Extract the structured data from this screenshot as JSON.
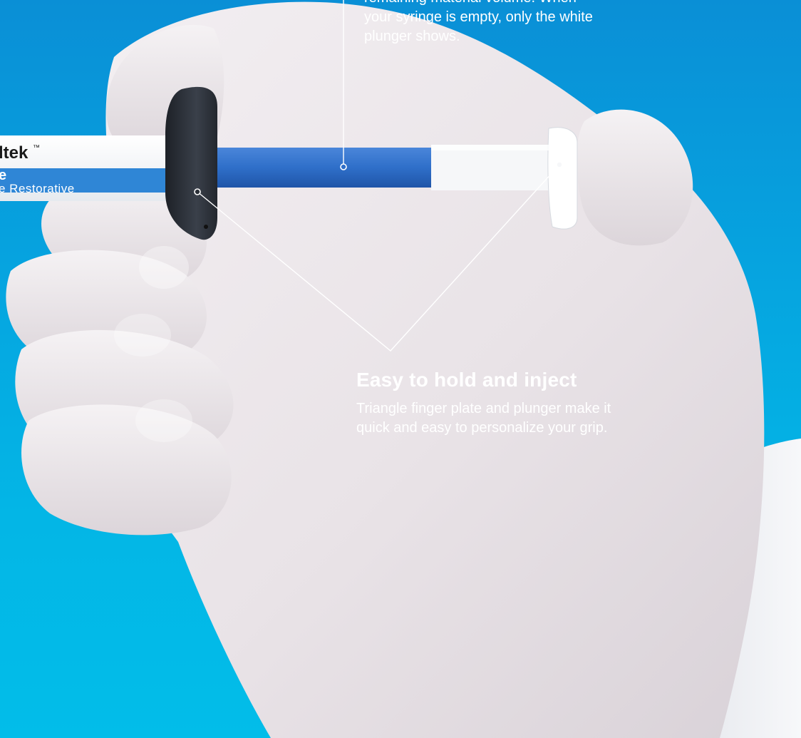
{
  "callouts": {
    "remaining_volume": {
      "lines": [
        "remaining material volume. When",
        "your syringe is empty, only the white",
        "plunger shows."
      ]
    },
    "easy_hold": {
      "heading": "Easy to hold and inject",
      "lines": [
        "Triangle finger plate and plunger make it",
        "quick and easy to personalize your grip."
      ]
    }
  },
  "syringe_label": {
    "brand": "ltek",
    "trademark": "™",
    "line2": "e",
    "line3": "e Restorative"
  },
  "colors": {
    "background_top": "#0a8fd6",
    "background_bottom": "#02bde9",
    "glove": "#ece7ea",
    "plunger_rod": "#2f6fc9",
    "finger_plate": "#2b3038",
    "plunger_cap": "#f6f7f9",
    "leader_line": "#ffffff"
  }
}
